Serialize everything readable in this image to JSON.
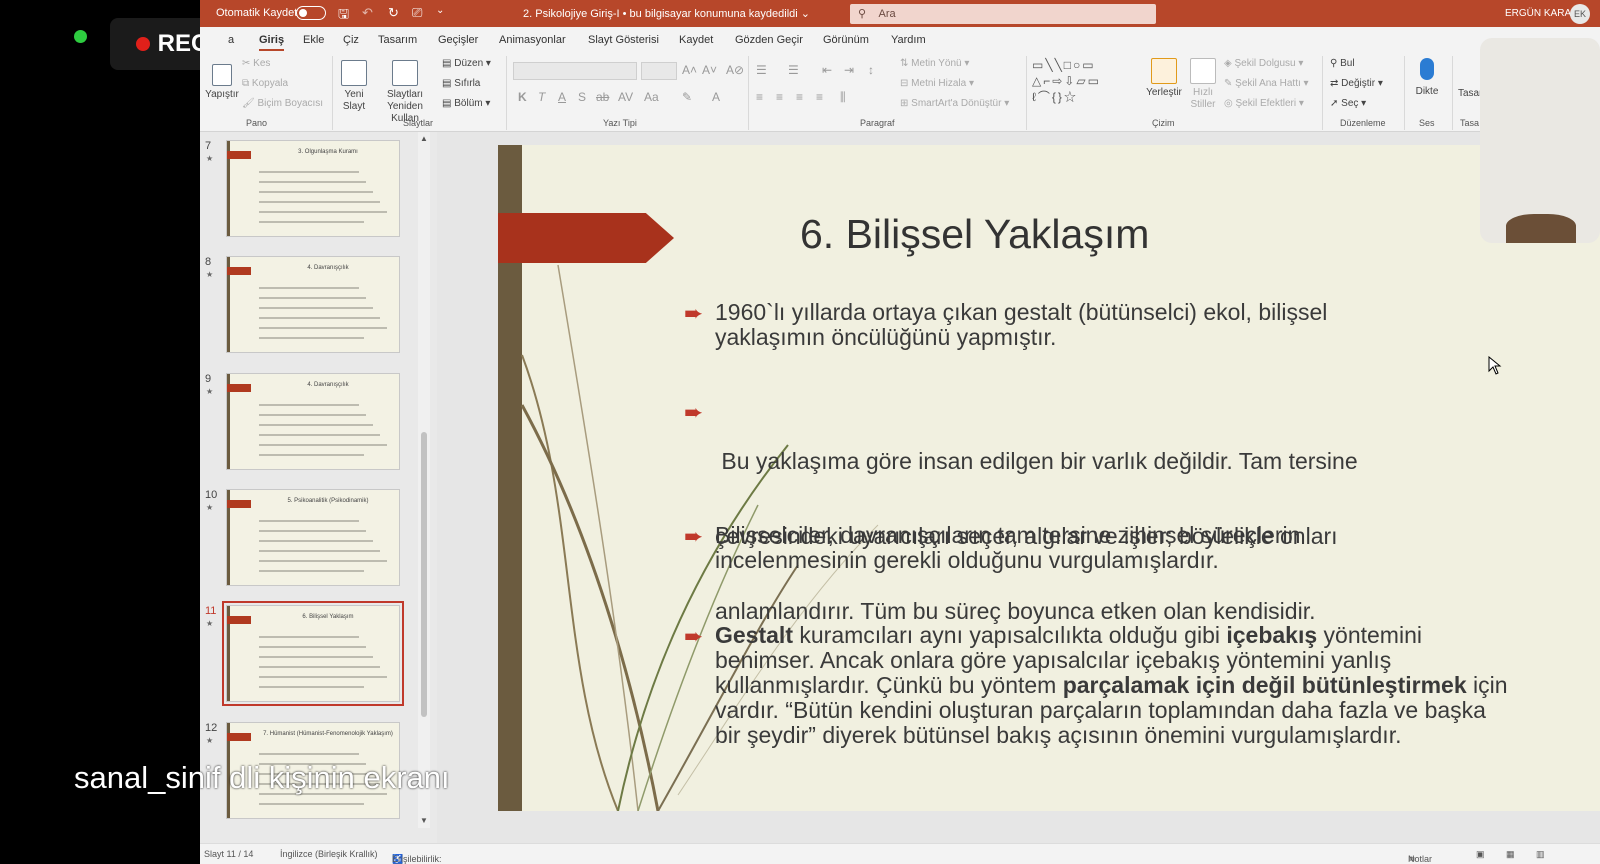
{
  "recording": {
    "label": "REC"
  },
  "titlebar": {
    "autosave_label": "Otomatik Kaydet",
    "document_title": "2. Psikolojiye Giriş-I  •  bu bilgisayar konumuna kaydedildi ⌄",
    "search_placeholder": "Ara",
    "user_name": "ERGÜN KARA",
    "user_initials": "EK"
  },
  "menu": {
    "tabs": [
      "Dosya",
      "Giriş",
      "Ekle",
      "Çiz",
      "Tasarım",
      "Geçişler",
      "Animasyonlar",
      "Slayt Gösterisi",
      "Kaydet",
      "Gözden Geçir",
      "Görünüm",
      "Yardım"
    ],
    "visible_first_tab_fragment": "a",
    "active_tab": "Giriş"
  },
  "ribbon": {
    "groups": {
      "pano": "Pano",
      "slaytlar": "Slaytlar",
      "yazi_tipi": "Yazı Tipi",
      "paragraf": "Paragraf",
      "cizim": "Çizim",
      "duzenleme": "Düzenleme",
      "ses": "Ses",
      "tasarim_fragment": "Tasa"
    },
    "paste": "Yapıştır",
    "cut": "Kes",
    "copy": "Kopyala",
    "format_painter": "Biçim Boyacısı",
    "new_slide": "Yeni Slayt",
    "reuse_slides": "Slaytları Yeniden Kullan",
    "layout": "Düzen",
    "reset": "Sıfırla",
    "section": "Bölüm",
    "text_direction": "Metin Yönü",
    "align_text": "Metni Hizala",
    "smartart": "SmartArt'a Dönüştür",
    "arrange": "Yerleştir",
    "quick_styles": "Hızlı Stiller",
    "shape_fill": "Şekil Dolgusu",
    "shape_outline": "Şekil Ana Hattı",
    "shape_effects": "Şekil Efektleri",
    "find": "Bul",
    "replace": "Değiştir",
    "select": "Seç",
    "dictate": "Dikte",
    "designer_fragment": "Tasarı"
  },
  "thumbnails": [
    {
      "number": "7",
      "title": "3. Olgunlaşma Kuramı",
      "active": false
    },
    {
      "number": "8",
      "title": "4. Davranışçılık",
      "active": false
    },
    {
      "number": "9",
      "title": "4. Davranışçılık",
      "active": false
    },
    {
      "number": "10",
      "title": "5. Psikoanalitik (Psikodinamik)",
      "active": false
    },
    {
      "number": "11",
      "title": "6. Bilişsel Yaklaşım",
      "active": true
    },
    {
      "number": "12",
      "title": "7. Hümanist (Hümanist-Fenomenolojik Yaklaşım)",
      "active": false
    }
  ],
  "slide": {
    "title": "6. Bilişsel Yaklaşım",
    "paragraphs": [
      {
        "lines": [
          "1960`lı yıllarda ortaya çıkan gestalt (bütünselci) ekol, bilişsel",
          "yaklaşımın öncülüğünü yapmıştır."
        ]
      },
      {
        "lines": [
          " Bu yaklaşıma göre insan edilgen bir varlık değildir. Tam tersine",
          "çevresindeki uyarıcıları seçer, algılar ve işler; böylelikle onları",
          "anlamlandırır. Tüm bu süreç boyunca etken olan kendisidir."
        ]
      },
      {
        "lines": [
          "Bilişselciler, davranışçıların tam tersine zihinsel süreçlerin",
          "incelenmesinin gerekli olduğunu vurgulamışlardır."
        ]
      },
      {
        "runs": [
          {
            "text": "Gestalt",
            "bold": true
          },
          {
            "text": " kuramcıları aynı yapısalcılıkta olduğu gibi ",
            "bold": false
          },
          {
            "text": "içebakış",
            "bold": true
          },
          {
            "text": " yöntemini benimser. Ancak onlara göre yapısalcılar içebakış yöntemini yanlış kullanmışlardır. Çünkü bu yöntem ",
            "bold": false
          },
          {
            "text": "parçalamak için değil bütünleştirmek",
            "bold": true
          },
          {
            "text": " için vardır. “Bütün kendini oluşturan parçaların toplamından daha fazla ve başka bir şeydir” diyerek bütünsel bakış açısının önemini vurgulamışlardır.",
            "bold": false
          }
        ]
      }
    ]
  },
  "overlay_text": "sanal_sinif          dli kişinin ekranı",
  "statusbar": {
    "slide_count": "Slayt 11 / 14",
    "language": "İngilizce (Birleşik Krallık)",
    "accessibility": "Erişilebilirlik: Önerilere göz atın",
    "notes": "Notlar"
  },
  "colors": {
    "accent": "#b7472a",
    "slide_bg": "#f1f0e0",
    "slide_arrow": "#a8321c",
    "slide_bar": "#6b5b3f",
    "active_thumb": "#c0392b"
  }
}
